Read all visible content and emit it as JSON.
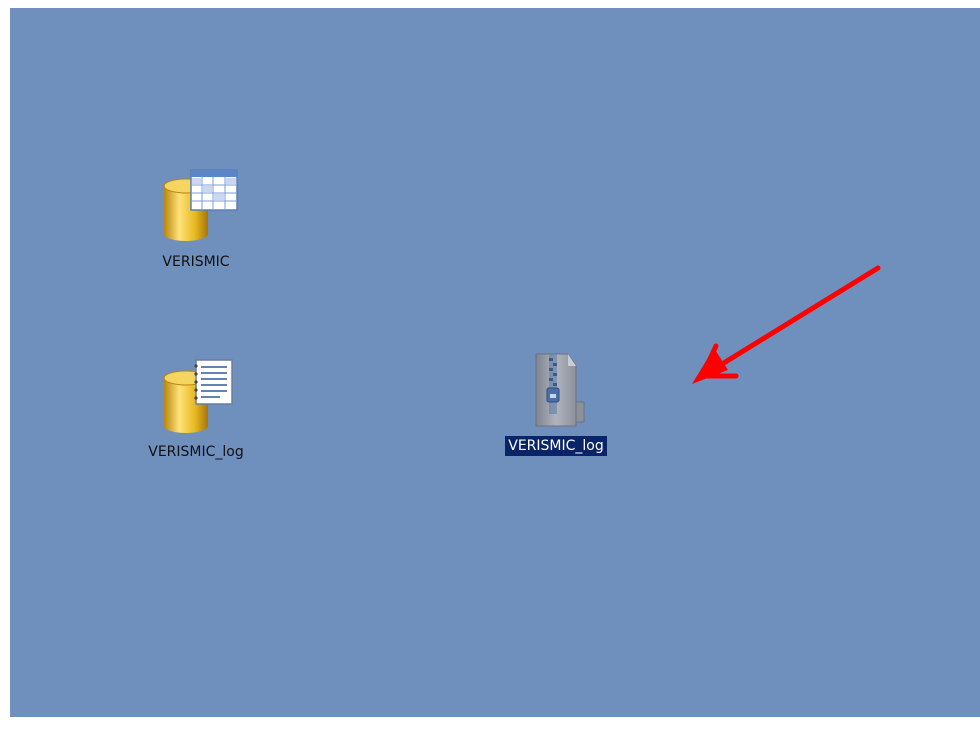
{
  "desktop": {
    "background": "#6f8fbd",
    "icons": [
      {
        "label": "VERISMIC",
        "icon": "database-table-icon",
        "selected": false
      },
      {
        "label": "VERISMIC_log",
        "icon": "database-log-icon",
        "selected": false
      },
      {
        "label": "VERISMIC_log",
        "icon": "zip-archive-icon",
        "selected": true
      }
    ]
  },
  "annotation": {
    "arrow_color": "#ff0000",
    "arrow_icon": "red-arrow-icon"
  }
}
